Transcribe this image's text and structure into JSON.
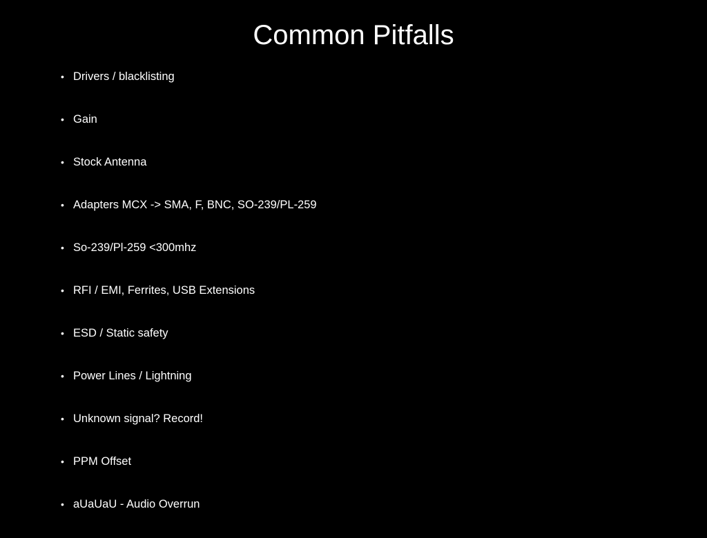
{
  "slide": {
    "title": "Common Pitfalls",
    "bullet_symbol": "•",
    "bullets": [
      "Drivers / blacklisting",
      "Gain",
      "Stock Antenna",
      "Adapters MCX -> SMA, F, BNC, SO-239/PL-259",
      "So-239/Pl-259 <300mhz",
      "RFI / EMI, Ferrites, USB Extensions",
      "ESD / Static safety",
      "Power Lines / Lightning",
      "Unknown signal? Record!",
      "PPM Offset",
      "aUaUaU - Audio Overrun"
    ]
  },
  "colors": {
    "background": "#000000",
    "text": "#ffffff"
  }
}
